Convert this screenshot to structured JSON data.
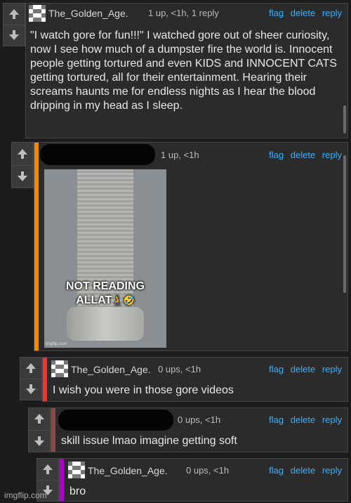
{
  "comments": [
    {
      "username": "The_Golden_Age.",
      "meta": "1 up, <1h, 1 reply",
      "text": "\"I watch gore for fun!!!\" I watched gore out of sheer curiosity, now I see how much of a dumpster fire the world is. Innocent people getting tortured and even KIDS and INNOCENT CATS getting tortured, all for their entertainment. Hearing their screams haunts me for endless nights as I hear the blood dripping in my head as I sleep."
    },
    {
      "username": "",
      "meta": "1 up, <1h",
      "stripe_color": "#f08a00",
      "image": {
        "caption_line1": "NOT READING",
        "caption_line2": "ALLAT",
        "caption_emoji": "🧎🤣",
        "watermark": "imgflip.com"
      }
    },
    {
      "username": "The_Golden_Age.",
      "meta": "0 ups, <1h",
      "stripe_color": "#e53935",
      "text": "I wish you were in those gore videos"
    },
    {
      "username": "",
      "meta": "0 ups, <1h",
      "stripe_color": "#8a4a44",
      "text": "skill issue lmao imagine getting soft"
    },
    {
      "username": "The_Golden_Age.",
      "meta": "0 ups, <1h",
      "stripe_color": "#b000d0",
      "text": "bro"
    }
  ],
  "actions": {
    "flag": "flag",
    "delete": "delete",
    "reply": "reply"
  },
  "watermark": "imgflip.com",
  "icons": {
    "upvote": "arrow-up-icon",
    "downvote": "arrow-down-icon",
    "avatar": "identicon-avatar-icon"
  }
}
